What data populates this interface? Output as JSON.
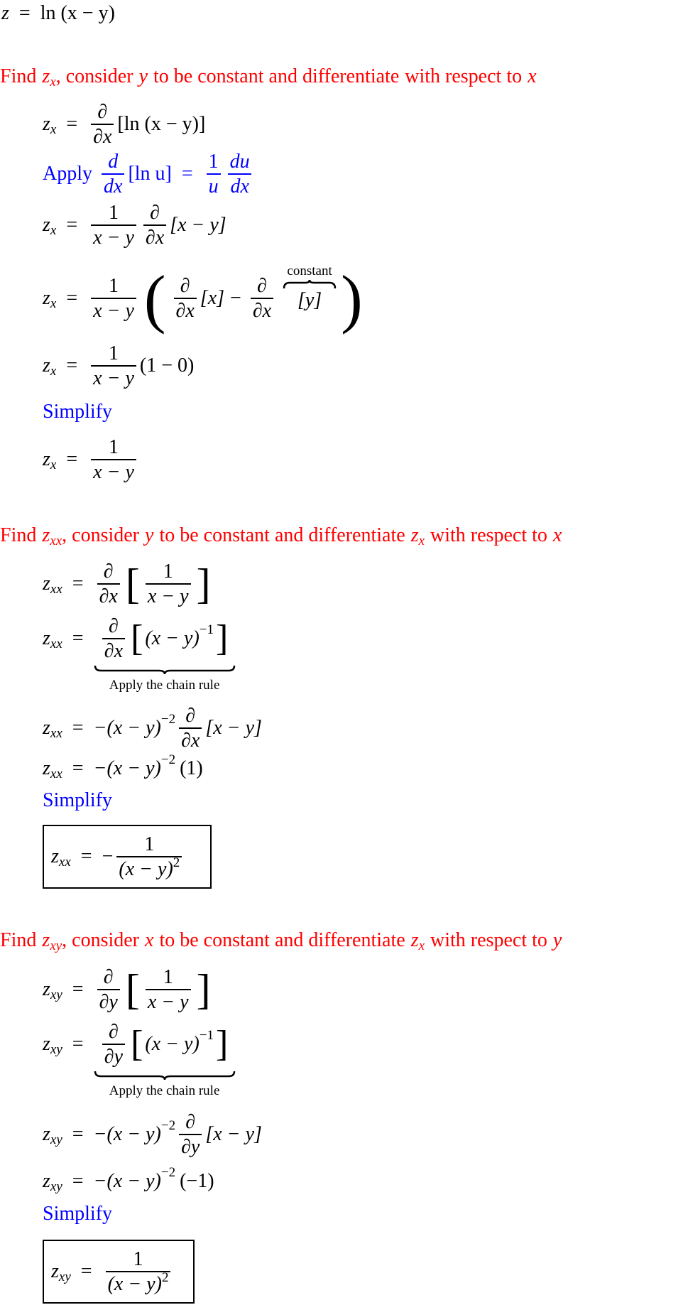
{
  "colors": {
    "heading": "#ff0000",
    "hint": "#0000ff",
    "text": "#000000"
  },
  "given": {
    "lhs": "z",
    "rhs": "ln (x − y)"
  },
  "sections": [
    {
      "heading": {
        "find": "Find",
        "target_base": "z",
        "target_sub": "x",
        "middle1": ", consider",
        "const_var": "y",
        "middle2": "to be constant and differentiate",
        "with_respect": "with respect to",
        "wrt_var": "x"
      },
      "steps": {
        "s1": {
          "lhs_base": "z",
          "lhs_sub": "x",
          "op_num": "∂",
          "op_den": "∂x",
          "arg": "[ln (x − y)]"
        },
        "hint": {
          "apply": "Apply",
          "d_num": "d",
          "d_den": "dx",
          "arg": "[ln u]",
          "eq": "=",
          "f1_num": "1",
          "f1_den": "u",
          "f2_num": "du",
          "f2_den": "dx"
        },
        "s2": {
          "lhs_base": "z",
          "lhs_sub": "x",
          "f_num": "1",
          "f_den": "x − y",
          "op_num": "∂",
          "op_den": "∂x",
          "arg": "[x − y]"
        },
        "s3": {
          "lhs_base": "z",
          "lhs_sub": "x",
          "f_num": "1",
          "f_den": "x − y",
          "op_num": "∂",
          "op_den": "∂x",
          "arg1": "[x]",
          "minus": "−",
          "arg2": "[y]",
          "overbrace_label": "constant"
        },
        "s4": {
          "lhs_base": "z",
          "lhs_sub": "x",
          "f_num": "1",
          "f_den": "x − y",
          "tail": "(1 − 0)"
        },
        "simplify": "Simplify",
        "s5": {
          "lhs_base": "z",
          "lhs_sub": "x",
          "f_num": "1",
          "f_den": "x − y"
        }
      }
    },
    {
      "heading": {
        "find": "Find",
        "target_base": "z",
        "target_sub": "xx",
        "middle1": ", consider",
        "const_var": "y",
        "middle2": "to be constant and differentiate",
        "zx_base": "z",
        "zx_sub": "x",
        "with_respect": "with respect to",
        "wrt_var": "x"
      },
      "steps": {
        "s1": {
          "lhs_base": "z",
          "lhs_sub": "xx",
          "op_num": "∂",
          "op_den": "∂x",
          "f_num": "1",
          "f_den": "x − y"
        },
        "s2": {
          "lhs_base": "z",
          "lhs_sub": "xx",
          "op_num": "∂",
          "op_den": "∂x",
          "arg": "(x − y)",
          "exp": "−1",
          "underbrace_label": "Apply the chain rule"
        },
        "s3": {
          "lhs_base": "z",
          "lhs_sub": "xx",
          "pre": "−(x − y)",
          "exp": "−2",
          "op_num": "∂",
          "op_den": "∂x",
          "arg": "[x − y]"
        },
        "s4": {
          "lhs_base": "z",
          "lhs_sub": "xx",
          "pre": "−(x − y)",
          "exp": "−2",
          "tail": "(1)"
        },
        "simplify": "Simplify",
        "result": {
          "lhs_base": "z",
          "lhs_sub": "xx",
          "sign": "−",
          "f_num": "1",
          "f_den": "(x − y)",
          "den_exp": "2"
        }
      }
    },
    {
      "heading": {
        "find": "Find",
        "target_base": "z",
        "target_sub": "xy",
        "middle1": ", consider",
        "const_var": "x",
        "middle2": "to be constant and differentiate",
        "zx_base": "z",
        "zx_sub": "x",
        "with_respect": "with respect to",
        "wrt_var": "y"
      },
      "steps": {
        "s1": {
          "lhs_base": "z",
          "lhs_sub": "xy",
          "op_num": "∂",
          "op_den": "∂y",
          "f_num": "1",
          "f_den": "x − y"
        },
        "s2": {
          "lhs_base": "z",
          "lhs_sub": "xy",
          "op_num": "∂",
          "op_den": "∂y",
          "arg": "(x − y)",
          "exp": "−1",
          "underbrace_label": "Apply the chain rule"
        },
        "s3": {
          "lhs_base": "z",
          "lhs_sub": "xy",
          "pre": "−(x − y)",
          "exp": "−2",
          "op_num": "∂",
          "op_den": "∂y",
          "arg": "[x − y]"
        },
        "s4": {
          "lhs_base": "z",
          "lhs_sub": "xy",
          "pre": "−(x − y)",
          "exp": "−2",
          "tail": "(−1)"
        },
        "simplify": "Simplify",
        "result": {
          "lhs_base": "z",
          "lhs_sub": "xy",
          "f_num": "1",
          "f_den": "(x − y)",
          "den_exp": "2"
        }
      }
    }
  ],
  "equals": "="
}
